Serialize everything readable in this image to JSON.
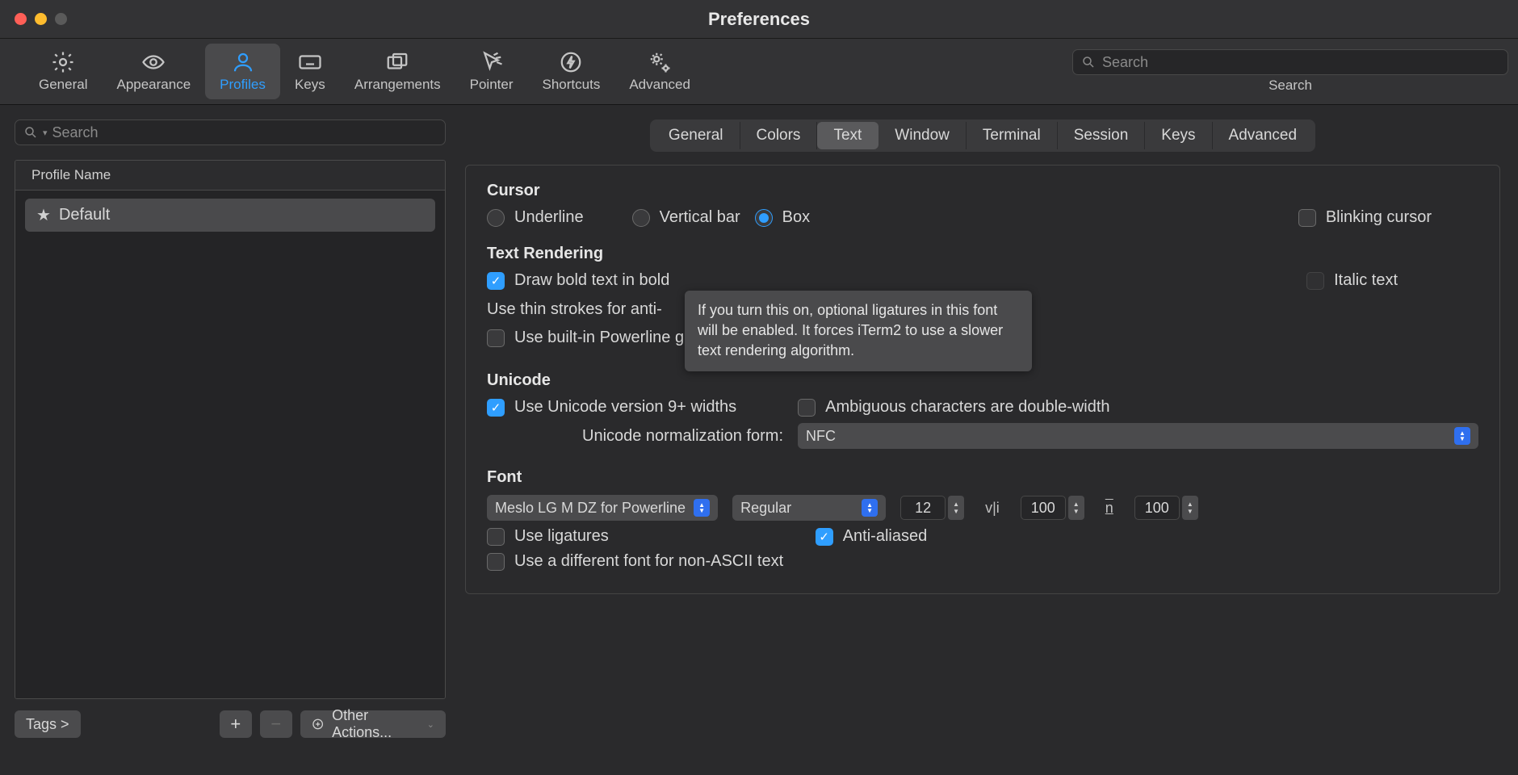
{
  "window": {
    "title": "Preferences"
  },
  "toolbar": {
    "items": [
      {
        "label": "General"
      },
      {
        "label": "Appearance"
      },
      {
        "label": "Profiles"
      },
      {
        "label": "Keys"
      },
      {
        "label": "Arrangements"
      },
      {
        "label": "Pointer"
      },
      {
        "label": "Shortcuts"
      },
      {
        "label": "Advanced"
      }
    ],
    "search_placeholder": "Search",
    "search_label": "Search"
  },
  "sidebar": {
    "search_placeholder": "Search",
    "header": "Profile Name",
    "rows": [
      {
        "name": "Default"
      }
    ],
    "tags_button": "Tags >",
    "actions_button": "Other Actions..."
  },
  "tabs": [
    "General",
    "Colors",
    "Text",
    "Window",
    "Terminal",
    "Session",
    "Keys",
    "Advanced"
  ],
  "cursor": {
    "title": "Cursor",
    "underline": "Underline",
    "vertical": "Vertical bar",
    "box": "Box",
    "blinking": "Blinking cursor"
  },
  "rendering": {
    "title": "Text Rendering",
    "bold": "Draw bold text in bold",
    "italic": "Italic text",
    "thin": "Use thin strokes for anti-",
    "powerline": "Use built-in Powerline glyphs"
  },
  "tooltip": "If you turn this on, optional ligatures in this font will be enabled. It forces iTerm2 to use a slower text rendering algorithm.",
  "unicode": {
    "title": "Unicode",
    "v9": "Use Unicode version 9+ widths",
    "ambig": "Ambiguous characters are double-width",
    "norm_label": "Unicode normalization form:",
    "norm_value": "NFC"
  },
  "font": {
    "title": "Font",
    "family": "Meslo LG M DZ for Powerline",
    "weight": "Regular",
    "size": "12",
    "hspace": "100",
    "vspace": "100",
    "ligatures": "Use ligatures",
    "aa": "Anti-aliased",
    "nonascii": "Use a different font for non-ASCII text"
  }
}
